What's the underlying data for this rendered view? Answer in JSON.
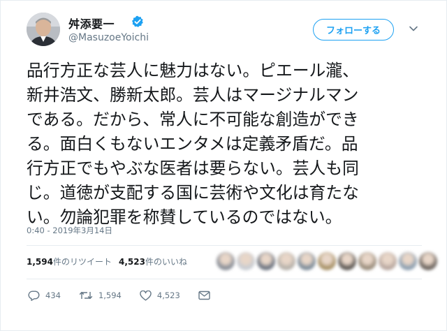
{
  "user": {
    "display_name": "舛添要一",
    "handle": "@MasuzoeYoichi",
    "verified_icon": "verified-badge-icon"
  },
  "follow_button": {
    "label": "フォローする"
  },
  "tweet": {
    "lines": [
      "品行方正な芸人に魅力はない。ピエール瀧、",
      "新井浩文、勝新太郎。芸人はマージナルマン",
      "である。だから、常人に不可能な創造ができ",
      "る。面白くもないエンタメは定義矛盾だ。品",
      "行方正でもやぶな医者は要らない。芸人も同",
      "じ。道徳が支配する国に芸術や文化は育たな",
      "い。勿論犯罪を称賛しているのではない。"
    ],
    "timestamp": "0:40 - 2019年3月14日"
  },
  "stats": {
    "retweet_count": "1,594",
    "retweet_label": "件のリツイート",
    "like_count": "4,523",
    "like_label": "件のいいね",
    "liker_avatar_colors": [
      "#8a8f98",
      "#c8ccd2",
      "#6d7480",
      "#b6b1aa",
      "#7e8c99",
      "#a89268",
      "#5f5a55",
      "#9a8d7c",
      "#b9a8a0",
      "#8d9fb0",
      "#6e6660"
    ]
  },
  "actions": {
    "reply": {
      "icon": "reply-icon",
      "count": "434"
    },
    "retweet": {
      "icon": "retweet-icon",
      "count": "1,594"
    },
    "like": {
      "icon": "heart-icon",
      "count": "4,523"
    },
    "message": {
      "icon": "direct-message-icon"
    }
  },
  "colors": {
    "accent": "#1da1f2",
    "secondary_text": "#657786",
    "primary_text": "#14171a",
    "divider": "#e6ecf0"
  }
}
